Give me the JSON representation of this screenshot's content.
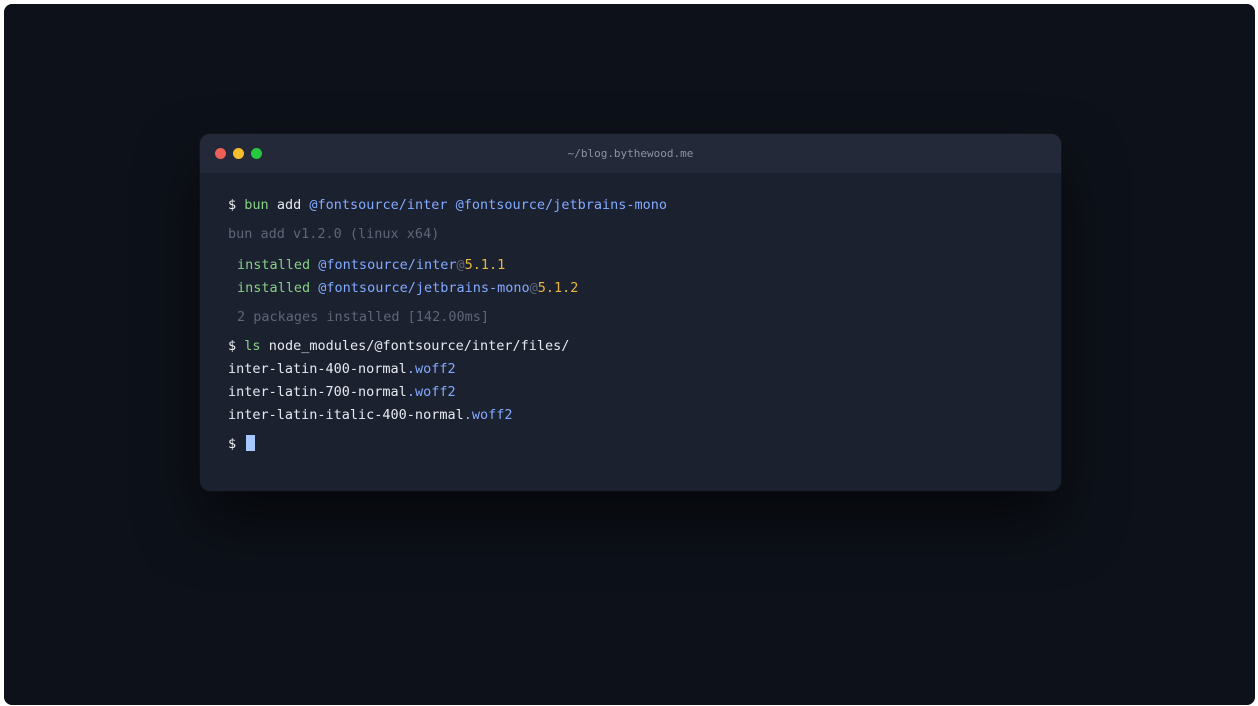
{
  "window": {
    "title": "~/blog.bythewood.me",
    "traffic_lights": [
      {
        "name": "close-button",
        "color": "#ee5f57"
      },
      {
        "name": "minimize-button",
        "color": "#f4bd2e"
      },
      {
        "name": "maximize-button",
        "color": "#27c840"
      }
    ]
  },
  "terminal": {
    "cmd1": {
      "prompt": "$",
      "program": "bun",
      "subcommand": "add",
      "arg1": "@fontsource/inter",
      "arg2": "@fontsource/jetbrains-mono"
    },
    "version_line": "bun add v1.2.0 (linux x64)",
    "installed": [
      {
        "word": "installed",
        "pkg": "@fontsource/inter",
        "at": "@",
        "version": "5.1.1"
      },
      {
        "word": "installed",
        "pkg": "@fontsource/jetbrains-mono",
        "at": "@",
        "version": "5.1.2"
      }
    ],
    "summary": "2 packages installed [142.00ms]",
    "cmd2": {
      "prompt": "$",
      "program": "ls",
      "path": "node_modules/@fontsource/inter/files/"
    },
    "files": [
      {
        "name": "inter-latin-400-normal",
        "ext": ".woff2"
      },
      {
        "name": "inter-latin-700-normal",
        "ext": ".woff2"
      },
      {
        "name": "inter-latin-italic-400-normal",
        "ext": ".woff2"
      }
    ],
    "final_prompt": "$"
  },
  "colors": {
    "stage_bg": "#0d1119",
    "window_bg": "#1c2130",
    "titlebar_bg": "#232938",
    "command_green": "#86d185",
    "package_blue": "#82aaff",
    "version_yellow": "#e6b83f",
    "muted_gray": "#5e6577",
    "cursor": "#a7c7ff"
  }
}
